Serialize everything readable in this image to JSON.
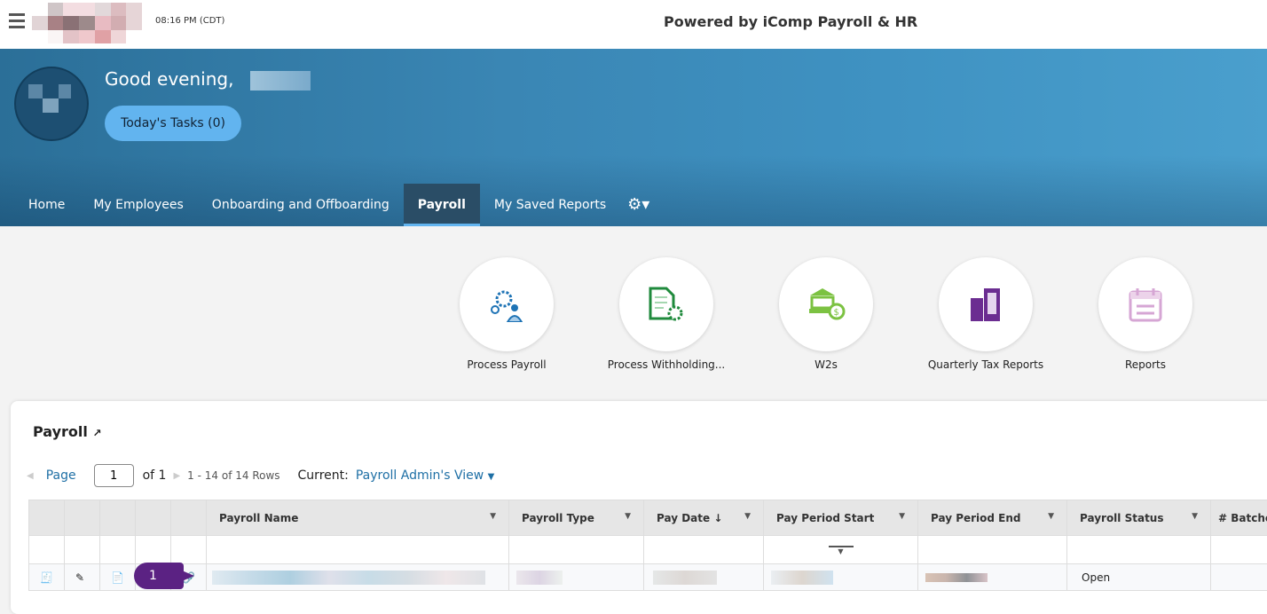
{
  "topbar": {
    "time": "08:16 PM (CDT)",
    "powered_by": "Powered by iComp Payroll & HR"
  },
  "banner": {
    "greeting": "Good evening,",
    "tasks_button": "Today's Tasks (0)"
  },
  "nav": {
    "tabs": [
      {
        "label": "Home"
      },
      {
        "label": "My Employees"
      },
      {
        "label": "Onboarding and Offboarding"
      },
      {
        "label": "Payroll",
        "active": true
      },
      {
        "label": "My Saved Reports"
      }
    ],
    "settings_icon": "gear-icon"
  },
  "tiles": [
    {
      "label": "Process Payroll",
      "icon": "people-gears-icon",
      "color": "#1e73b5"
    },
    {
      "label": "Process Withholding...",
      "icon": "document-gear-icon",
      "color": "#1f8a3c"
    },
    {
      "label": "W2s",
      "icon": "bank-dollar-icon",
      "color": "#7cc242"
    },
    {
      "label": "Quarterly Tax Reports",
      "icon": "building-icon",
      "color": "#6b2d91"
    },
    {
      "label": "Reports",
      "icon": "calendar-icon",
      "color": "#d6a6d4"
    }
  ],
  "panel": {
    "title": "Payroll",
    "pager": {
      "page_label": "Page",
      "page_value": "1",
      "of_label": "of 1",
      "rows": "1 - 14 of 14 Rows",
      "current_label": "Current:",
      "view": "Payroll Admin's View"
    },
    "columns": [
      "Payroll Name",
      "Payroll Type",
      "Pay Date",
      "Pay Period Start",
      "Pay Period End",
      "Payroll Status",
      "# Batche"
    ],
    "rows": [
      {
        "status": "Open"
      }
    ],
    "callout": "1"
  }
}
